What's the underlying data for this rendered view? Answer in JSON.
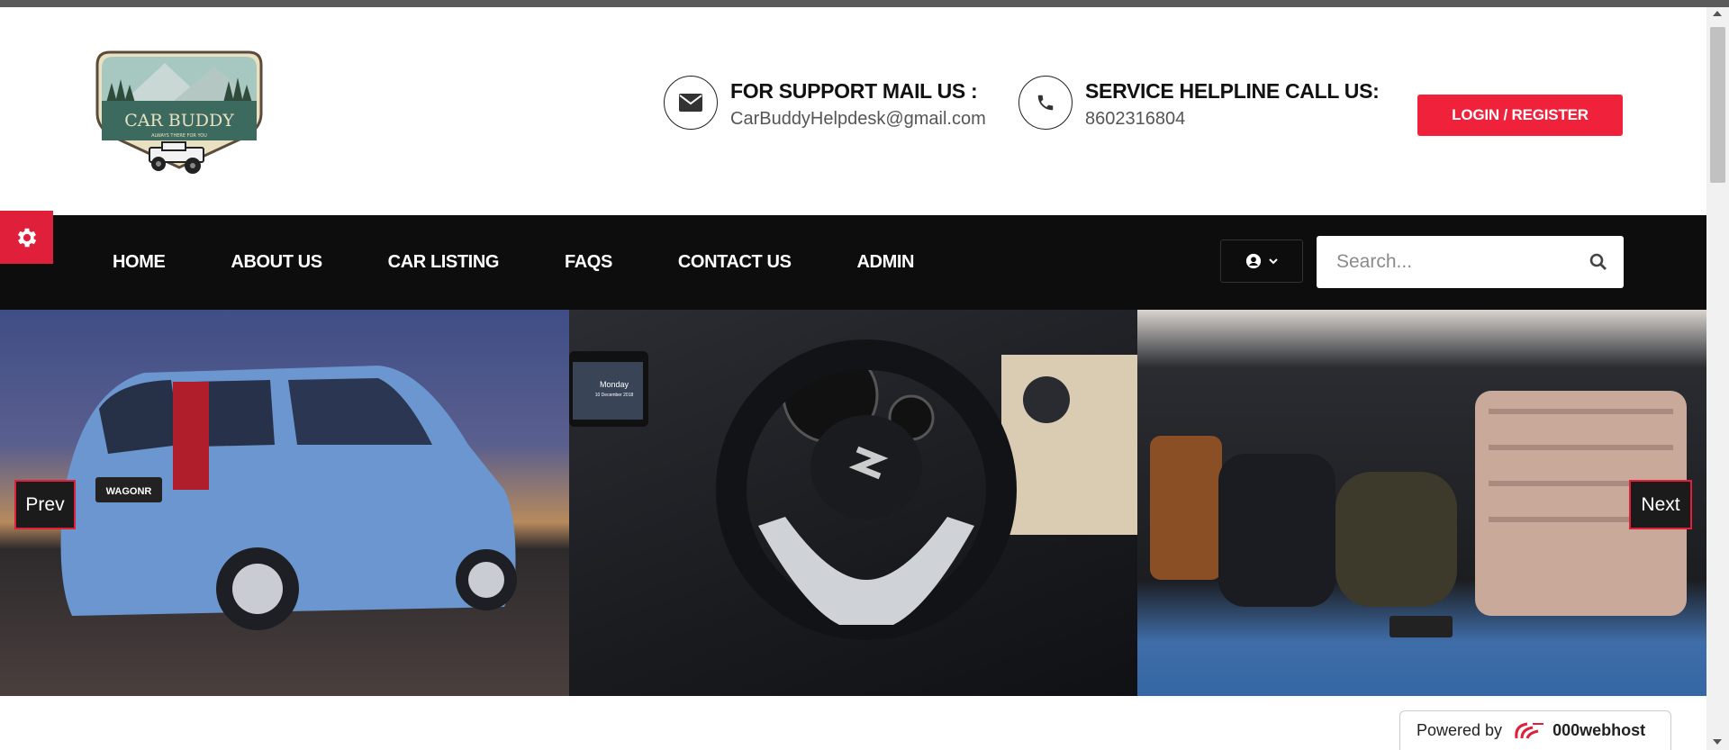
{
  "colors": {
    "accent": "#f0213a",
    "nav_bg": "#0d0d0d",
    "text_dark": "#111111"
  },
  "logo": {
    "alt": "CAR BUDDY",
    "name": "CAR BUDDY",
    "tagline": "ALWAYS THERE FOR YOU"
  },
  "support": {
    "title": "FOR SUPPORT MAIL US :",
    "value": "CarBuddyHelpdesk@gmail.com",
    "icon": "envelope-icon"
  },
  "helpline": {
    "title": "SERVICE HELPLINE CALL US:",
    "value": "8602316804",
    "icon": "phone-icon"
  },
  "login_label": "LOGIN / REGISTER",
  "nav": {
    "items": [
      {
        "label": "HOME"
      },
      {
        "label": "ABOUT US"
      },
      {
        "label": "CAR LISTING"
      },
      {
        "label": "FAQS"
      },
      {
        "label": "CONTACT US"
      },
      {
        "label": "ADMIN"
      }
    ],
    "user_icon": "user-circle-icon",
    "search_placeholder": "Search..."
  },
  "slider": {
    "prev_label": "Prev",
    "next_label": "Next",
    "slides": [
      {
        "alt": "Blue WagonR car exterior",
        "badge_text": "WAGONR"
      },
      {
        "alt": "Car steering wheel interior",
        "screen_day": "Monday",
        "screen_date": "10 December 2018"
      },
      {
        "alt": "Car boot with luggage"
      }
    ]
  },
  "powered_by": {
    "prefix": "Powered by",
    "brand": "000webhost"
  }
}
